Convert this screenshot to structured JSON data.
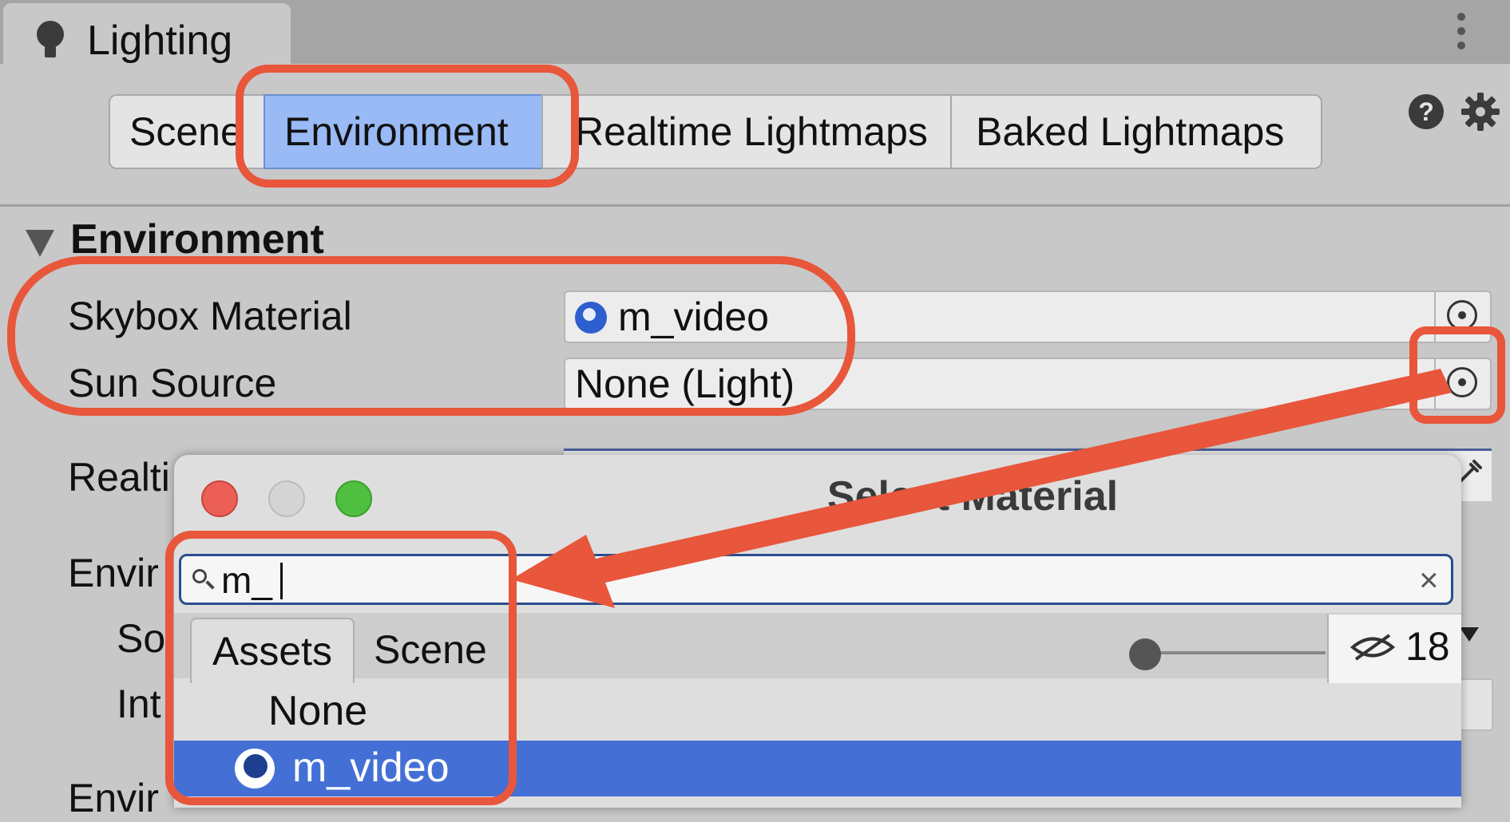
{
  "window": {
    "title": "Lighting"
  },
  "toolbar": {
    "tabs": [
      {
        "label": "Scene",
        "active": false
      },
      {
        "label": "Environment",
        "active": true
      },
      {
        "label": "Realtime Lightmaps",
        "active": false
      },
      {
        "label": "Baked Lightmaps",
        "active": false
      }
    ]
  },
  "environment": {
    "section_title": "Environment",
    "skybox_label": "Skybox Material",
    "skybox_value": "m_video",
    "sun_label": "Sun Source",
    "sun_value": "None (Light)",
    "partial_labels": {
      "realtime": "Realti",
      "environment": "Envir",
      "source": "So",
      "intensity": "Int",
      "environment2": "Envir"
    }
  },
  "dialog": {
    "title": "Select Material",
    "search_value": "m_",
    "tabs": [
      "Assets",
      "Scene"
    ],
    "hidden_count": "18",
    "items": [
      {
        "label": "None",
        "selected": false
      },
      {
        "label": "m_video",
        "selected": true
      }
    ]
  },
  "colors": {
    "annotation": "#e8563b",
    "active_tab": "#99baf5",
    "selection": "#4470d6"
  },
  "icons": [
    "light-bulb-icon",
    "kebab-menu-icon",
    "help-icon",
    "gear-icon",
    "object-picker-icon",
    "eyedropper-icon",
    "search-icon",
    "clear-icon",
    "hidden-eye-icon",
    "material-icon"
  ]
}
